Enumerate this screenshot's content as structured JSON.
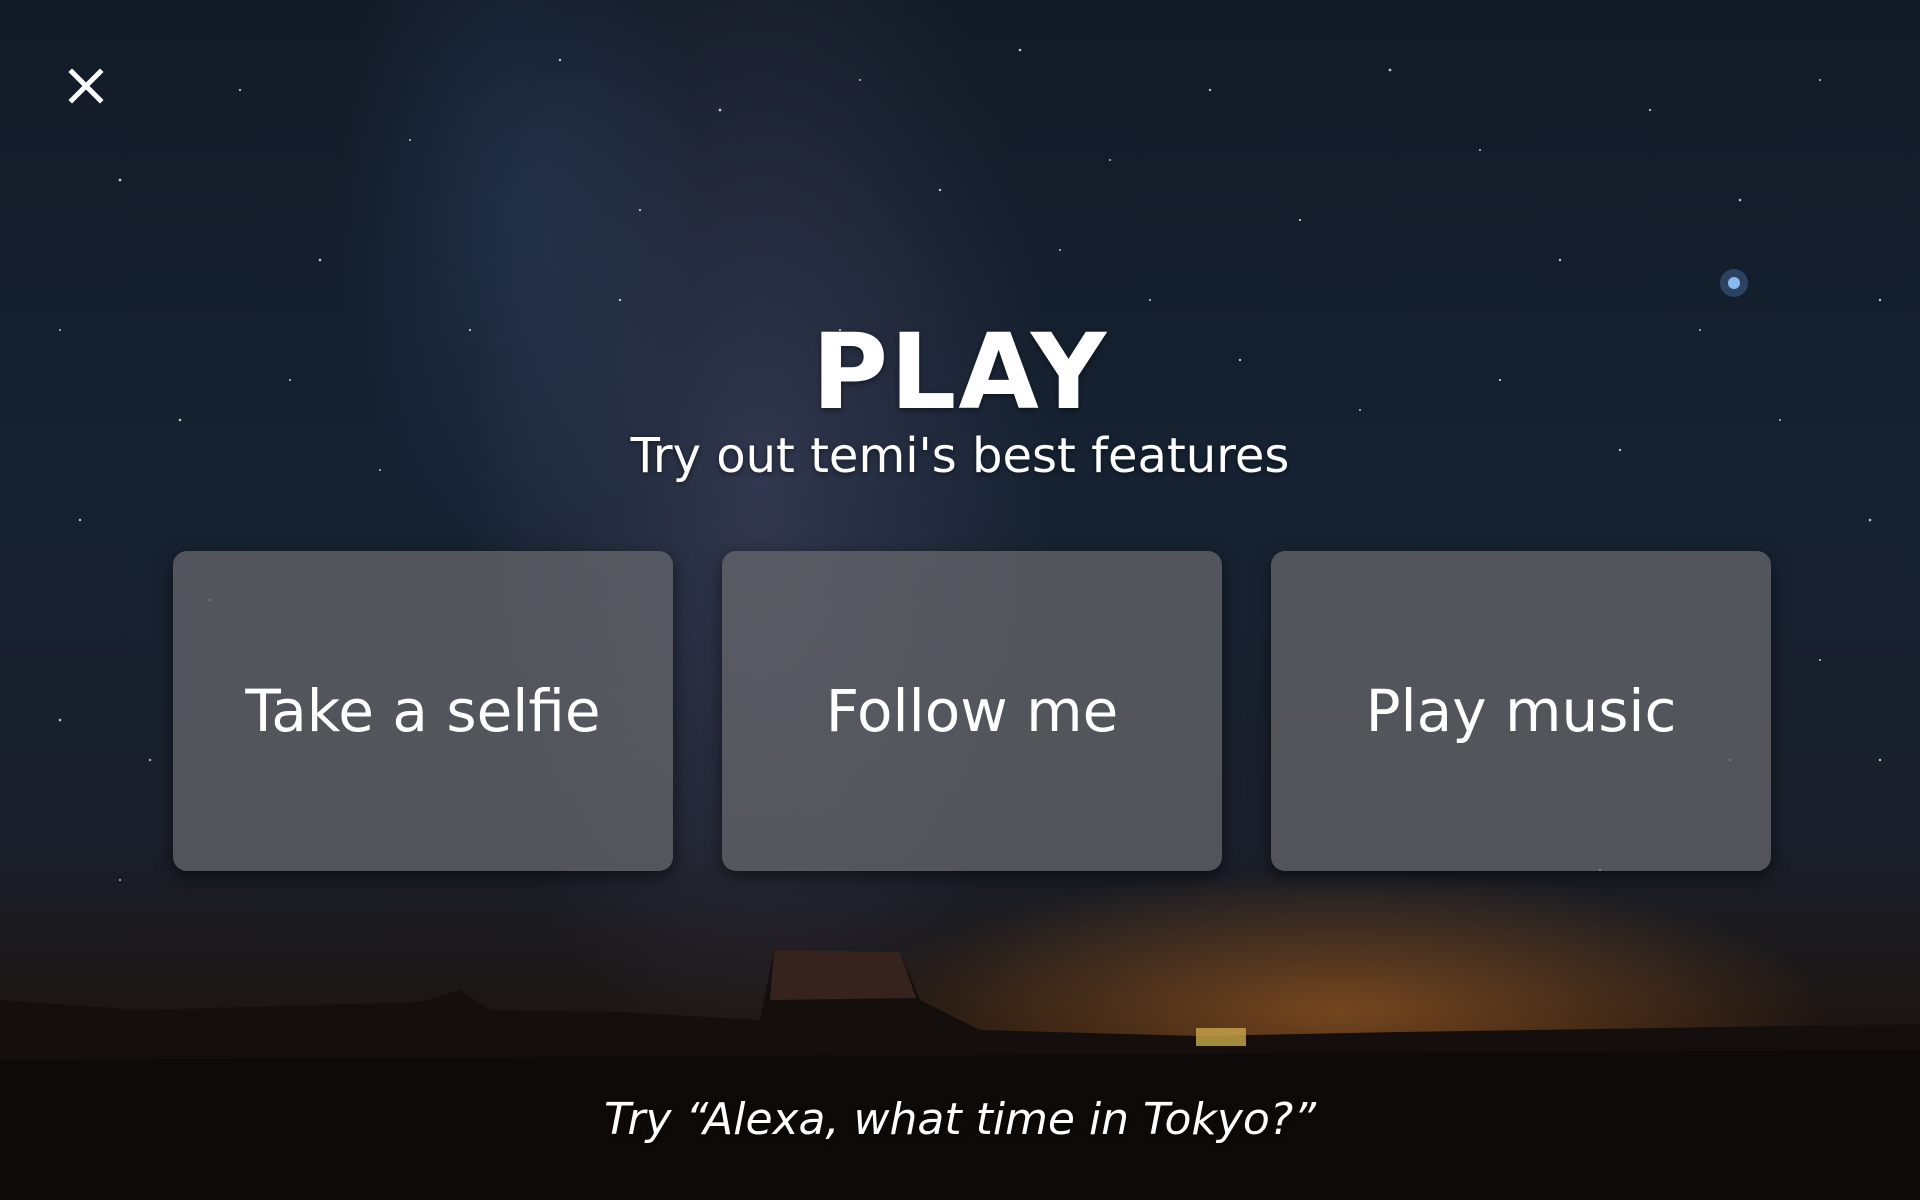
{
  "screen": {
    "close_icon": "close-icon",
    "title": "PLAY",
    "subtitle": "Try out temi's best features",
    "features": [
      {
        "label": "Take a selfie"
      },
      {
        "label": "Follow me"
      },
      {
        "label": "Play music"
      }
    ],
    "hint": "Try “Alexa, what time in Tokyo?”"
  },
  "colors": {
    "text": "#ffffff",
    "card_background": "#69696e",
    "sky": "#162232",
    "horizon_glow": "#be6e28"
  }
}
